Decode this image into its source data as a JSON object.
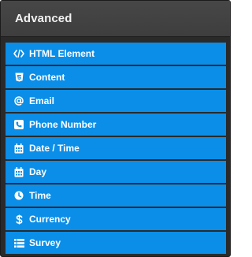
{
  "panel": {
    "title": "Advanced",
    "items": [
      {
        "label": "HTML Element",
        "icon": "code-icon"
      },
      {
        "label": "Content",
        "icon": "html5-icon"
      },
      {
        "label": "Email",
        "icon": "at-icon"
      },
      {
        "label": "Phone Number",
        "icon": "phone-icon"
      },
      {
        "label": "Date / Time",
        "icon": "calendar-icon"
      },
      {
        "label": "Day",
        "icon": "calendar-icon"
      },
      {
        "label": "Time",
        "icon": "clock-icon"
      },
      {
        "label": "Currency",
        "icon": "dollar-icon"
      },
      {
        "label": "Survey",
        "icon": "list-icon"
      }
    ]
  },
  "colors": {
    "item_background": "#0b8ee8",
    "header_background": "#444444",
    "panel_background": "#2a2a2a"
  }
}
